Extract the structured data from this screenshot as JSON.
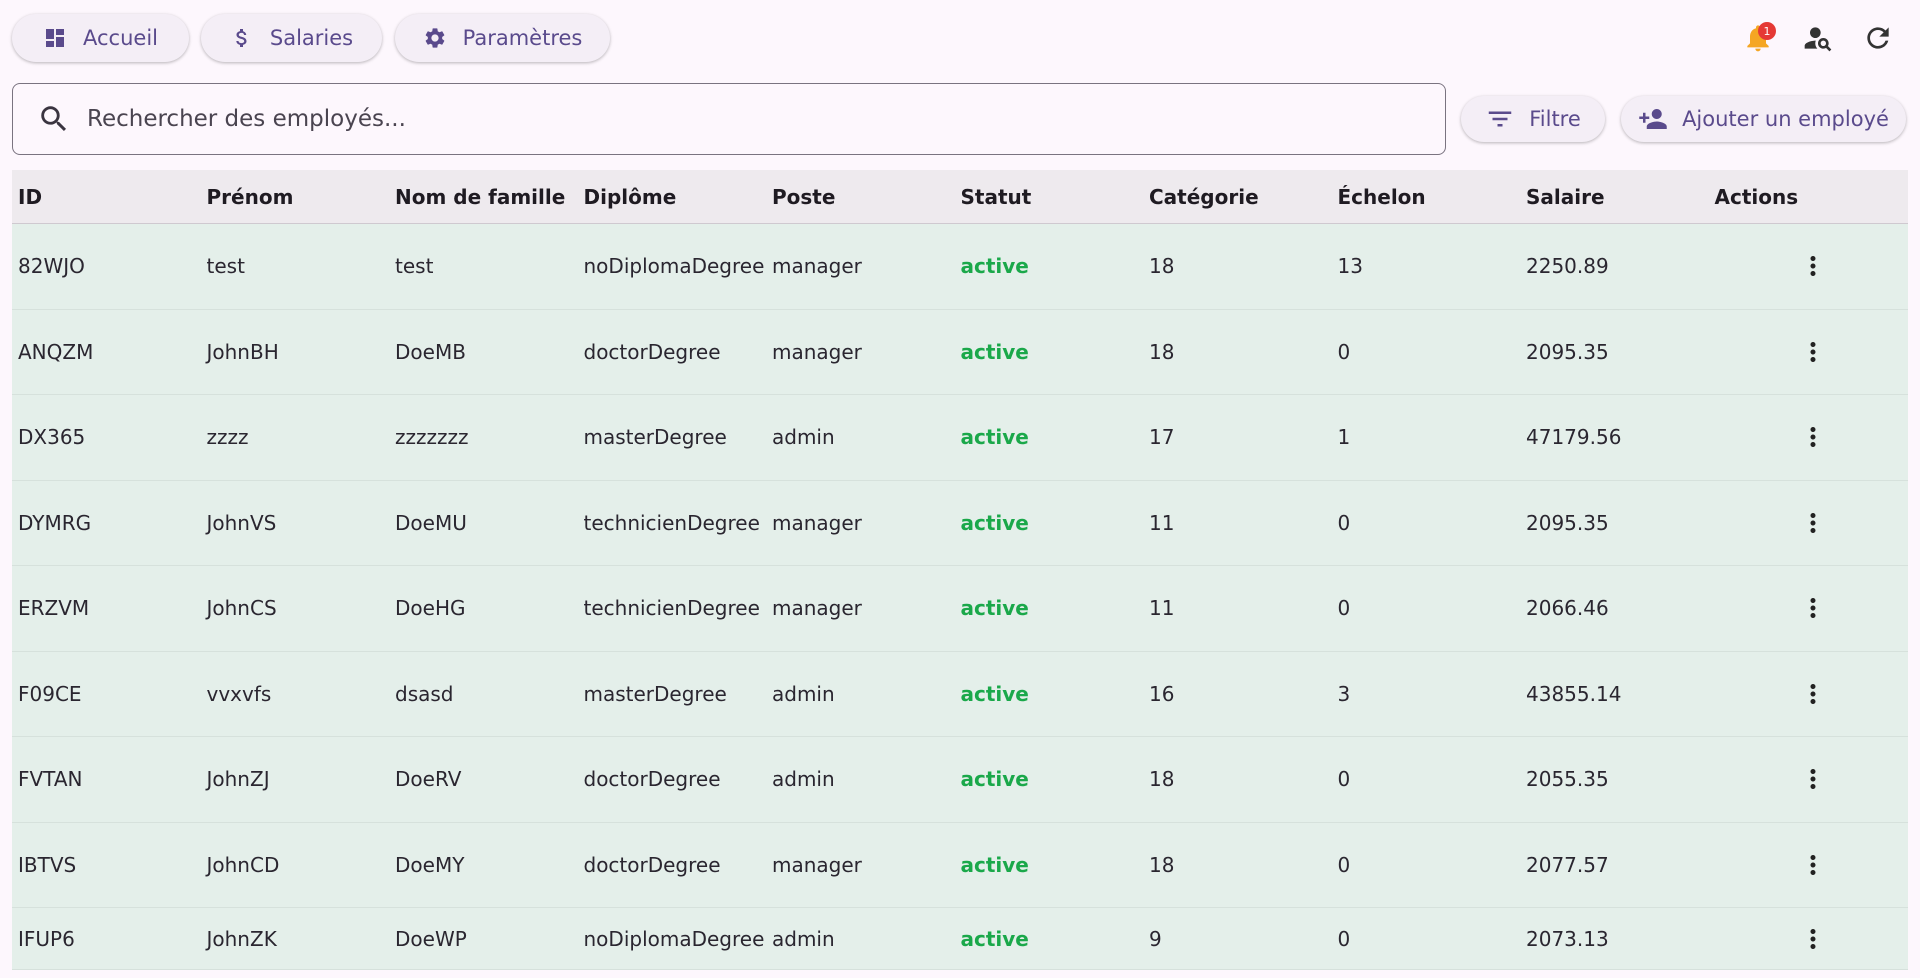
{
  "nav": {
    "home_label": "Accueil",
    "salaries_label": "Salaries",
    "settings_label": "Paramètres"
  },
  "top_icons": {
    "notifications": "bell-icon",
    "notification_count": "1",
    "user_search": "person-search-icon",
    "refresh": "refresh-icon"
  },
  "search": {
    "placeholder": "Rechercher des employés..."
  },
  "toolbar": {
    "filter_label": "Filtre",
    "add_employee_label": "Ajouter un employé"
  },
  "table": {
    "headers": [
      "ID",
      "Prénom",
      "Nom de famille",
      "Diplôme",
      "Poste",
      "Statut",
      "Catégorie",
      "Échelon",
      "Salaire",
      "Actions"
    ],
    "rows": [
      {
        "id": "82WJO",
        "first": "test",
        "last": "test",
        "diploma": "noDiplomaDegree",
        "post": "manager",
        "status": "active",
        "category": "18",
        "echelon": "13",
        "salary": "2250.89"
      },
      {
        "id": "ANQZM",
        "first": "JohnBH",
        "last": "DoeMB",
        "diploma": "doctorDegree",
        "post": "manager",
        "status": "active",
        "category": "18",
        "echelon": "0",
        "salary": "2095.35"
      },
      {
        "id": "DX365",
        "first": "zzzz",
        "last": "zzzzzzz",
        "diploma": "masterDegree",
        "post": "admin",
        "status": "active",
        "category": "17",
        "echelon": "1",
        "salary": "47179.56"
      },
      {
        "id": "DYMRG",
        "first": "JohnVS",
        "last": "DoeMU",
        "diploma": "technicienDegree",
        "post": "manager",
        "status": "active",
        "category": "11",
        "echelon": "0",
        "salary": "2095.35"
      },
      {
        "id": "ERZVM",
        "first": "JohnCS",
        "last": "DoeHG",
        "diploma": "technicienDegree",
        "post": "manager",
        "status": "active",
        "category": "11",
        "echelon": "0",
        "salary": "2066.46"
      },
      {
        "id": "F09CE",
        "first": "vvxvfs",
        "last": "dsasd",
        "diploma": "masterDegree",
        "post": "admin",
        "status": "active",
        "category": "16",
        "echelon": "3",
        "salary": "43855.14"
      },
      {
        "id": "FVTAN",
        "first": "JohnZJ",
        "last": "DoeRV",
        "diploma": "doctorDegree",
        "post": "admin",
        "status": "active",
        "category": "18",
        "echelon": "0",
        "salary": "2055.35"
      },
      {
        "id": "IBTVS",
        "first": "JohnCD",
        "last": "DoeMY",
        "diploma": "doctorDegree",
        "post": "manager",
        "status": "active",
        "category": "18",
        "echelon": "0",
        "salary": "2077.57"
      },
      {
        "id": "IFUP6",
        "first": "JohnZK",
        "last": "DoeWP",
        "diploma": "noDiplomaDegree",
        "post": "admin",
        "status": "active",
        "category": "9",
        "echelon": "0",
        "salary": "2073.13"
      }
    ]
  },
  "colors": {
    "accent": "#5a4a8c",
    "status_active": "#1aa84a",
    "row_bg": "#e4efea",
    "notification_bell": "#f5a623",
    "badge": "#e53935"
  }
}
